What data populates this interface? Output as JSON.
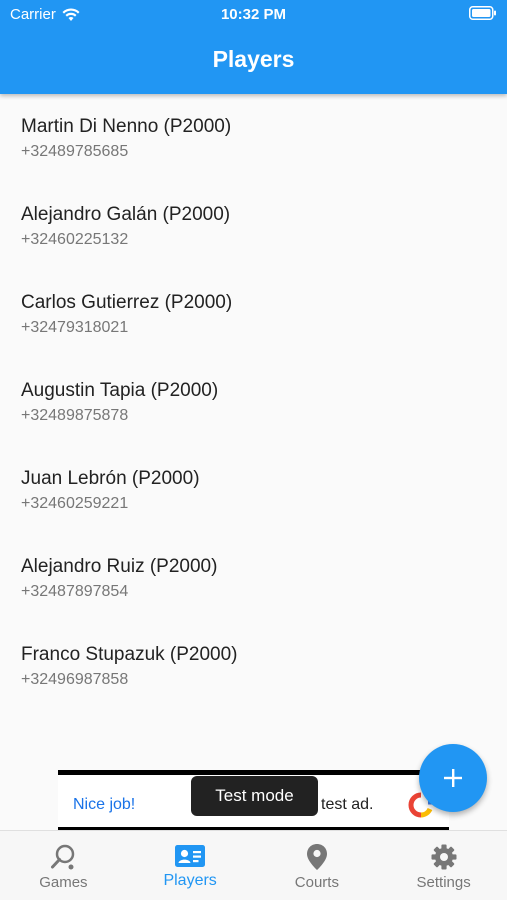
{
  "status_bar": {
    "carrier": "Carrier",
    "time": "10:32 PM"
  },
  "header": {
    "title": "Players"
  },
  "players": [
    {
      "name": "Martin Di Nenno (P2000)",
      "phone": "+32489785685"
    },
    {
      "name": "Alejandro Galán (P2000)",
      "phone": "+32460225132"
    },
    {
      "name": "Carlos Gutierrez (P2000)",
      "phone": "+32479318021"
    },
    {
      "name": "Augustin Tapia (P2000)",
      "phone": "+32489875878"
    },
    {
      "name": "Juan Lebrón (P2000)",
      "phone": "+32460259221"
    },
    {
      "name": "Alejandro Ruiz (P2000)",
      "phone": "+32487897854"
    },
    {
      "name": "Franco Stupazuk (P2000)",
      "phone": "+32496987858"
    }
  ],
  "ad_banner": {
    "left_text": "Nice job!",
    "right_text": "test ad.",
    "toast": "Test mode"
  },
  "fab": {
    "icon": "plus-icon"
  },
  "tabs": [
    {
      "label": "Games",
      "icon": "search-icon",
      "active": false
    },
    {
      "label": "Players",
      "icon": "contact-card-icon",
      "active": true
    },
    {
      "label": "Courts",
      "icon": "location-pin-icon",
      "active": false
    },
    {
      "label": "Settings",
      "icon": "gear-icon",
      "active": false
    }
  ],
  "colors": {
    "primary": "#2196f3",
    "background": "#fafafa",
    "inactive_tab": "#777777"
  }
}
